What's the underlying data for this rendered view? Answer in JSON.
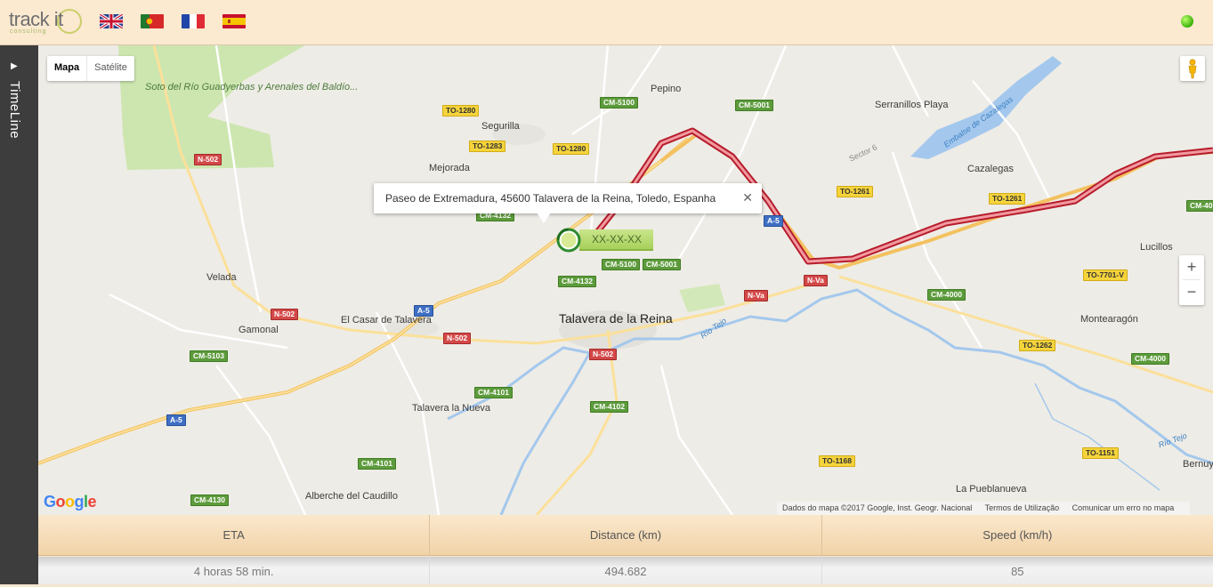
{
  "header": {
    "logo_text": "track it",
    "logo_sub": "consulting",
    "flags": [
      {
        "name": "flag-uk",
        "lang": "English"
      },
      {
        "name": "flag-portugal",
        "lang": "Português"
      },
      {
        "name": "flag-france",
        "lang": "Français"
      },
      {
        "name": "flag-spain",
        "lang": "Español"
      }
    ],
    "status_color": "#3ab00a"
  },
  "sidebar": {
    "toggle_icon": "triangle-right-icon",
    "label": "TimeLine"
  },
  "map": {
    "type_control": {
      "map_label": "Mapa",
      "satellite_label": "Satélite"
    },
    "popup": {
      "address": "Paseo de Extremadura, 45600 Talavera de la Reina, Toledo, Espanha",
      "close": "✕"
    },
    "vehicle_label": "XX-XX-XX",
    "zoom_in": "+",
    "zoom_out": "−",
    "attribution": {
      "data": "Dados do mapa ©2017 Google, Inst. Geogr. Nacional",
      "terms": "Termos de Utilização",
      "report": "Comunicar um erro no mapa"
    },
    "places": {
      "soto": "Soto del Río Guadyerbas y Arenales del Baldío...",
      "pepino": "Pepino",
      "segurilla": "Segurilla",
      "mejorada": "Mejorada",
      "serranillos": "Serranillos Playa",
      "cazalegas": "Cazalegas",
      "embalse": "Embalse de Cazalegas",
      "sector6": "Sector 6",
      "velada": "Velada",
      "gamonal": "Gamonal",
      "elcasar": "El Casar de Talavera",
      "talavera": "Talavera de la Reina",
      "talavera_nueva": "Talavera la Nueva",
      "alberche": "Alberche del Caudillo",
      "lucillos": "Lucillos",
      "montearagon": "Montearagón",
      "pueblanueva": "La Pueblanueva",
      "bernuy": "Bernuy",
      "rio_tejo_1": "Río Tejo",
      "rio_tejo_2": "Río Tejo"
    },
    "roads": {
      "to1280a": "TO-1280",
      "to1283": "TO-1283",
      "to1280b": "TO-1280",
      "cm5100a": "CM-5100",
      "cm5001a": "CM-5001",
      "n502a": "N-502",
      "cm4132a": "CM-4132",
      "to1261a": "TO-1261",
      "to1261b": "TO-1261",
      "a5a": "A-5",
      "cm5100b": "CM-5100",
      "cm5001b": "CM-5001",
      "cm4132b": "CM-4132",
      "nva1": "N-Va",
      "nva2": "N-Va",
      "n502b": "N-502",
      "a5b": "A-5",
      "n502c": "N-502",
      "n502d": "N-502",
      "cm4000a": "CM-4000",
      "to7701": "TO-7701-V",
      "cm40x": "CM-40",
      "cm5103": "CM-5103",
      "cm4101a": "CM-4101",
      "cm4102": "CM-4102",
      "to1262": "TO-1262",
      "cm4000b": "CM-4000",
      "a5c": "A-5",
      "cm4101b": "CM-4101",
      "to1168": "TO-1168",
      "to1151": "TO-1151",
      "cm4130": "CM-4130"
    }
  },
  "stats": {
    "headers": [
      "ETA",
      "Distance (km)",
      "Speed (km/h)"
    ],
    "values": [
      "4 horas 58 min.",
      "494.682",
      "85"
    ]
  }
}
